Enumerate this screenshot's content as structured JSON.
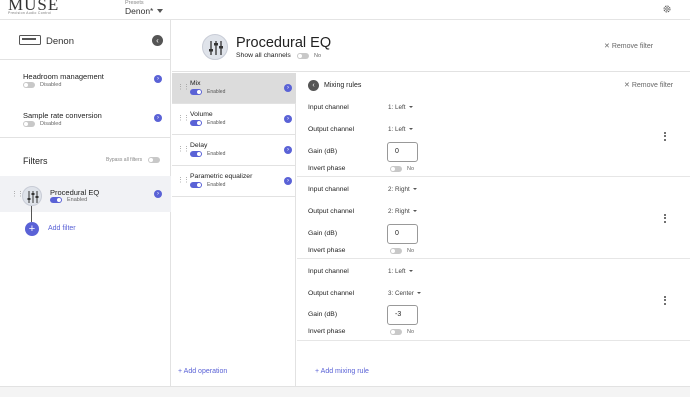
{
  "topbar": {
    "logo": "MUSE",
    "logo_sub": "Precision Audio Control",
    "presets_label": "Presets",
    "preset_value": "Denon*"
  },
  "sidebar": {
    "device_name": "Denon",
    "settings": [
      {
        "title": "Headroom management",
        "state": "Disabled"
      },
      {
        "title": "Sample rate conversion",
        "state": "Disabled"
      }
    ],
    "filters_heading": "Filters",
    "bypass_label": "Bypass all filters",
    "filter": {
      "name": "Procedural EQ",
      "state": "Enabled"
    },
    "add_filter": "Add filter"
  },
  "header": {
    "title": "Procedural EQ",
    "show_all_label": "Show all channels",
    "show_all_state": "No",
    "remove_filter": "Remove filter"
  },
  "operations": {
    "items": [
      {
        "name": "Mix",
        "state": "Enabled"
      },
      {
        "name": "Volume",
        "state": "Enabled"
      },
      {
        "name": "Delay",
        "state": "Enabled"
      },
      {
        "name": "Parametric equalizer",
        "state": "Enabled"
      }
    ],
    "add_label": "Add operation"
  },
  "mixing": {
    "title": "Mixing rules",
    "remove_label": "Remove filter",
    "labels": {
      "input": "Input channel",
      "output": "Output channel",
      "gain": "Gain (dB)",
      "invert": "Invert phase"
    },
    "rules": [
      {
        "input": "1: Left",
        "output": "1: Left",
        "gain": "0",
        "invert": "No"
      },
      {
        "input": "2: Right",
        "output": "2: Right",
        "gain": "0",
        "invert": "No"
      },
      {
        "input": "1: Left",
        "output": "3: Center",
        "gain": "-3",
        "invert": "No"
      }
    ],
    "add_rule": "Add mixing rule"
  },
  "colors": {
    "accent": "#5a62d6",
    "active_op": "#dcdcdc"
  }
}
